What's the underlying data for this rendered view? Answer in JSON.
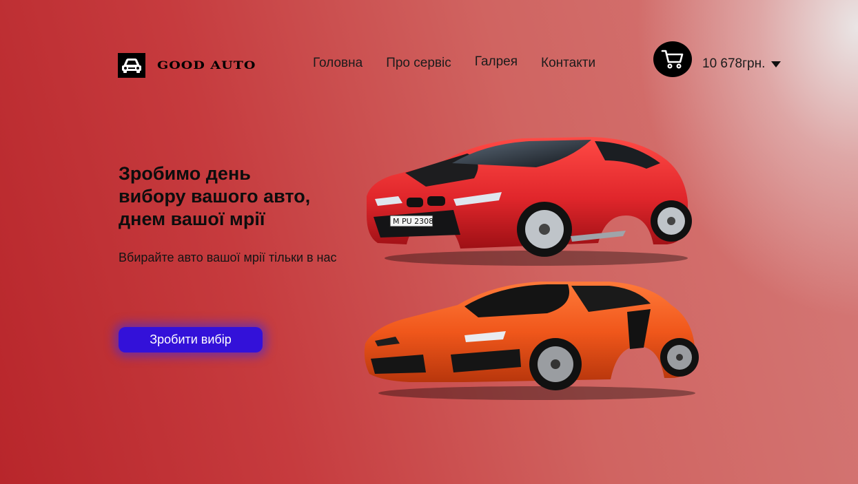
{
  "brand": {
    "name": "GOOD AUTO",
    "logo_icon": "car-front-icon"
  },
  "nav": {
    "items": [
      {
        "label": "Головна"
      },
      {
        "label": "Про сервіс"
      },
      {
        "label": "Галрея"
      },
      {
        "label": "Контакти"
      }
    ]
  },
  "cart": {
    "icon": "cart-icon",
    "balance": "10 678грн.",
    "dropdown_icon": "caret-down-icon"
  },
  "hero": {
    "title_lines": [
      "Зробимо день",
      "вибору вашого авто,",
      "днем вашої мрії"
    ],
    "subtitle": "Вбирайте авто вашої мрії тільки в нас",
    "cta_label": "Зробити вибір"
  },
  "cars": {
    "top": {
      "plate": "M PU 2308",
      "color": "#e0262b"
    },
    "bottom": {
      "color": "#f0571b"
    }
  },
  "colors": {
    "accent": "#3311d9",
    "background_primary": "#c63b3e",
    "text": "#0d0d0d"
  }
}
